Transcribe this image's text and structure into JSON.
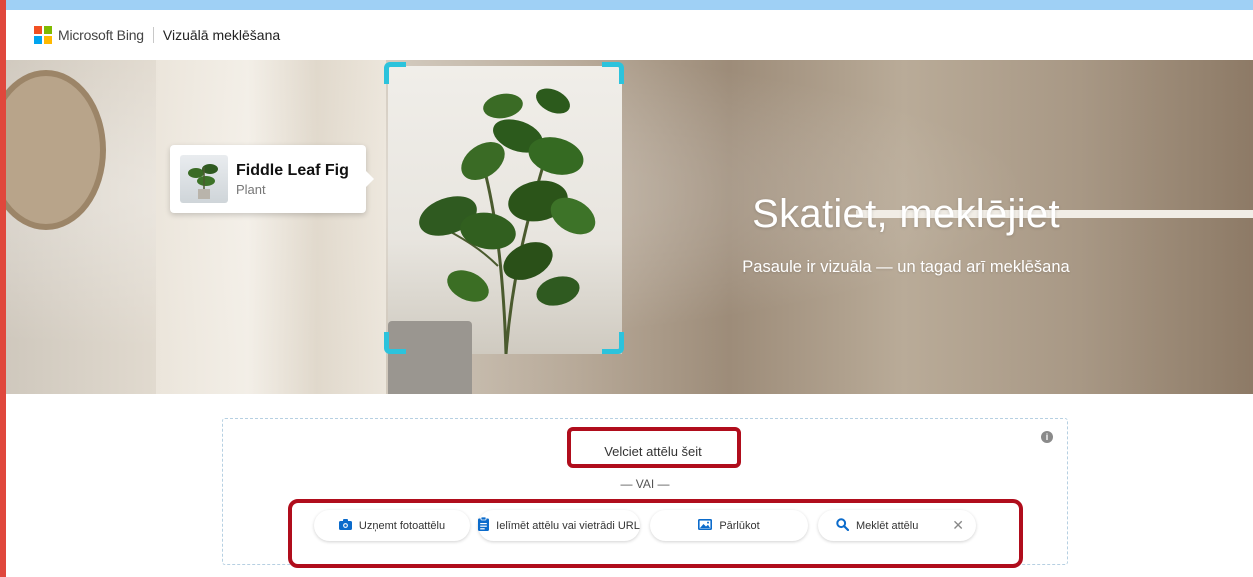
{
  "header": {
    "brand": "Microsoft Bing",
    "title": "Vizuālā meklēšana"
  },
  "hero": {
    "title": "Skatiet, meklējiet",
    "subtitle": "Pasaule ir vizuāla — un tagad arī meklēšana",
    "card": {
      "name": "Fiddle Leaf Fig",
      "category": "Plant"
    }
  },
  "dropzone": {
    "drag_text": "Velciet attēlu šeit",
    "or_text": "— VAI —",
    "buttons": {
      "camera": "Uzņemt fotoattēlu",
      "paste": "Ielīmēt attēlu vai vietrādi URL",
      "browse": "Pārlūkot",
      "search": "Meklēt attēlu"
    }
  },
  "colors": {
    "accent": "#2cc3dc",
    "icon_blue": "#0b6bcb",
    "highlight": "#b00d1c",
    "top_band": "#9fd0f5",
    "left_band": "#e0473c"
  },
  "icons": {
    "camera": "camera-icon",
    "paste": "clipboard-icon",
    "browse": "image-icon",
    "search": "search-icon",
    "close": "close-icon",
    "info": "info-icon"
  }
}
